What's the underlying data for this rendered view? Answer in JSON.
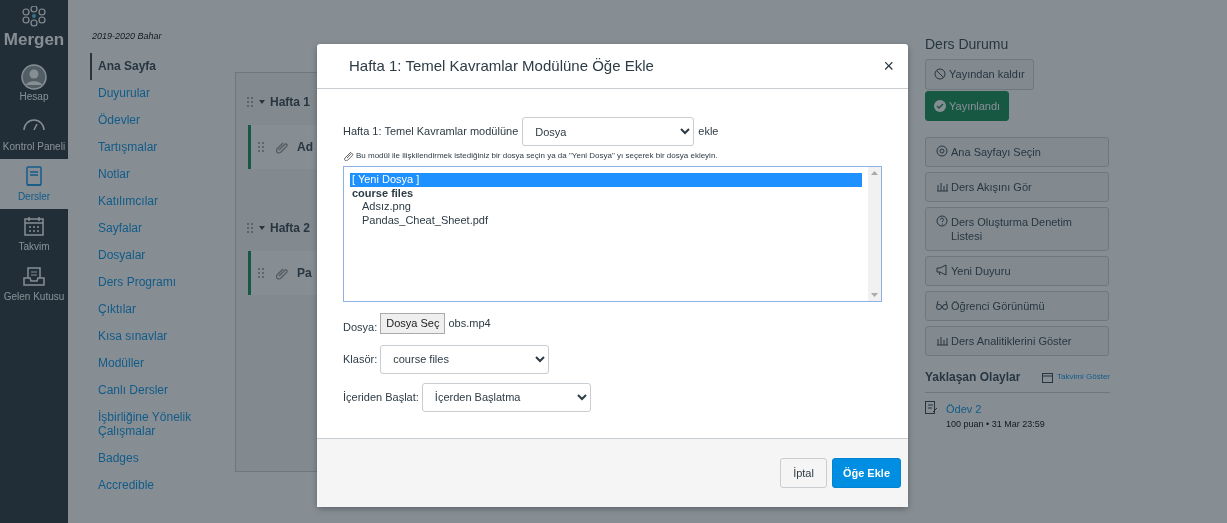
{
  "global_nav": {
    "logo": "Mergen",
    "items": [
      {
        "label": "Hesap",
        "kind": "account",
        "selected": false
      },
      {
        "label": "Kontrol Paneli",
        "kind": "dashboard",
        "selected": false
      },
      {
        "label": "Dersler",
        "kind": "courses",
        "selected": true
      },
      {
        "label": "Takvim",
        "kind": "calendar",
        "selected": false
      },
      {
        "label": "Gelen Kutusu",
        "kind": "inbox",
        "selected": false
      }
    ]
  },
  "course_nav": {
    "term": "2019-2020 Bahar",
    "items": [
      {
        "label": "Ana Sayfa",
        "selected": true
      },
      {
        "label": "Duyurular",
        "selected": false
      },
      {
        "label": "Ödevler",
        "selected": false
      },
      {
        "label": "Tartışmalar",
        "selected": false
      },
      {
        "label": "Notlar",
        "selected": false
      },
      {
        "label": "Katılımcılar",
        "selected": false
      },
      {
        "label": "Sayfalar",
        "selected": false
      },
      {
        "label": "Dosyalar",
        "selected": false
      },
      {
        "label": "Ders Programı",
        "selected": false
      },
      {
        "label": "Çıktılar",
        "selected": false
      },
      {
        "label": "Kısa sınavlar",
        "selected": false
      },
      {
        "label": "Modüller",
        "selected": false
      },
      {
        "label": "Canlı Dersler",
        "selected": false
      },
      {
        "label": "İşbirliğine Yönelik Çalışmalar",
        "selected": false
      },
      {
        "label": "Badges",
        "selected": false
      },
      {
        "label": "Accredible",
        "selected": false
      }
    ]
  },
  "modules": [
    {
      "title": "Hafta 1",
      "items": [
        "Ad"
      ]
    },
    {
      "title": "Hafta 2",
      "items": [
        "Pa"
      ]
    }
  ],
  "sidebar": {
    "heading": "Ders Durumu",
    "status_buttons": [
      {
        "label": "Yayından kaldır",
        "kind": "unpublish"
      },
      {
        "label": "Yayınlandı",
        "kind": "published"
      }
    ],
    "actions": [
      {
        "label": "Ana Sayfayı Seçin",
        "kind": "target"
      },
      {
        "label": "Ders Akışını Gör",
        "kind": "chart"
      },
      {
        "label": "Ders Oluşturma Denetim Listesi",
        "kind": "question"
      },
      {
        "label": "Yeni Duyuru",
        "kind": "megaphone"
      },
      {
        "label": "Öğrenci Görünümü",
        "kind": "glasses"
      },
      {
        "label": "Ders Analitiklerini Göster",
        "kind": "chart"
      }
    ],
    "upcoming": {
      "heading": "Yaklaşan Olaylar",
      "calendar_link": "Takvimi Göster",
      "events": [
        {
          "title": "Ödev 2",
          "details": "100 puan • 31 Mar 23:59"
        }
      ]
    }
  },
  "modal": {
    "title": "Hafta 1: Temel Kavramlar Modülüne Öğe Ekle",
    "close": "×",
    "type_label": "Hafta 1: Temel Kavramlar modülüne",
    "type_value": "Dosya",
    "type_suffix": "ekle",
    "hint": "Bu modül ile ilişkilendirmek istediğiniz bir dosya seçin ya da \"Yeni Dosya\" yı seçerek bir dosya ekleyin.",
    "file_list": [
      {
        "label": "[ Yeni Dosya ]",
        "kind": "option",
        "selected": true
      },
      {
        "label": "course files",
        "kind": "group",
        "selected": false,
        "children": [
          {
            "label": "Adsız.png",
            "selected": false
          },
          {
            "label": "Pandas_Cheat_Sheet.pdf",
            "selected": false
          }
        ]
      }
    ],
    "file": {
      "label": "Dosya:",
      "button": "Dosya Seç",
      "filename": "obs.mp4"
    },
    "folder": {
      "label": "Klasör:",
      "value": "course files"
    },
    "launch": {
      "label": "İçeriden Başlat:",
      "value": "İçerden Başlatma"
    },
    "buttons": [
      {
        "label": "İptal",
        "kind": "secondary"
      },
      {
        "label": "Öğe Ekle",
        "kind": "primary"
      }
    ]
  }
}
